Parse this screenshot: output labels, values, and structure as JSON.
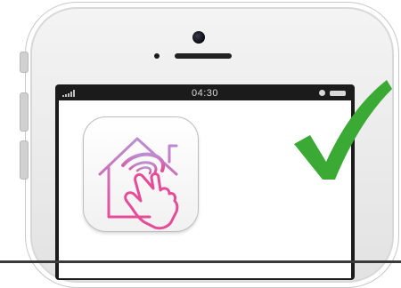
{
  "device": {
    "type": "smartphone",
    "color": "#ececec"
  },
  "status_bar": {
    "time": "04:30",
    "signal_icon": "signal-bars-icon",
    "status_icon": "circle-status-icon",
    "battery_icon": "battery-icon"
  },
  "screen": {
    "app_icon": {
      "icon": "home-hand-tap-icon",
      "accent_color": "#d9469c"
    }
  },
  "overlay": {
    "icon": "checkmark-icon",
    "color": "#3aaa35"
  }
}
